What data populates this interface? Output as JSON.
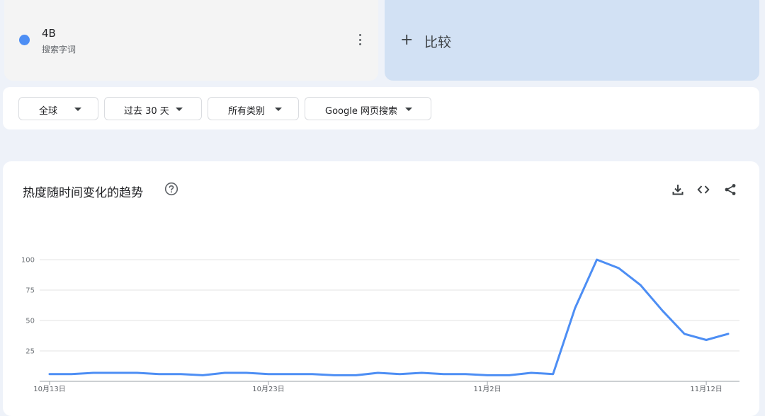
{
  "term": {
    "name": "4B",
    "type": "搜索字词",
    "color": "#4d8ef4"
  },
  "compare": {
    "label": "比较"
  },
  "filters": {
    "region": "全球",
    "time": "过去 30 天",
    "category": "所有类别",
    "search_type": "Google 网页搜索"
  },
  "chart": {
    "title": "热度随时间变化的趋势",
    "icons": [
      "help-icon",
      "download-icon",
      "embed-code-icon",
      "share-icon"
    ]
  },
  "chart_data": {
    "type": "line",
    "line_color": "#4d8ef4",
    "x": [
      "10月13日",
      "10月14日",
      "10月15日",
      "10月16日",
      "10月17日",
      "10月18日",
      "10月19日",
      "10月20日",
      "10月21日",
      "10月22日",
      "10月23日",
      "10月24日",
      "10月25日",
      "10月26日",
      "10月27日",
      "10月28日",
      "10月29日",
      "10月30日",
      "10月31日",
      "11月1日",
      "11月2日",
      "11月3日",
      "11月4日",
      "11月5日",
      "11月6日",
      "11月7日",
      "11月8日",
      "11月9日",
      "11月10日",
      "11月11日",
      "11月12日",
      "11月13日"
    ],
    "series": [
      {
        "values": [
          6,
          6,
          7,
          7,
          7,
          6,
          6,
          5,
          7,
          7,
          6,
          6,
          6,
          5,
          5,
          7,
          6,
          7,
          6,
          6,
          5,
          5,
          7,
          6,
          60,
          100,
          93,
          79,
          58,
          39,
          34,
          39
        ]
      }
    ],
    "x_tick_labels": [
      "10月13日",
      "10月23日",
      "11月2日",
      "11月12日"
    ],
    "x_tick_indices": [
      0,
      10,
      20,
      30
    ],
    "y_ticks": [
      25,
      50,
      75,
      100
    ],
    "ylim": [
      0,
      100
    ],
    "grid": true
  }
}
